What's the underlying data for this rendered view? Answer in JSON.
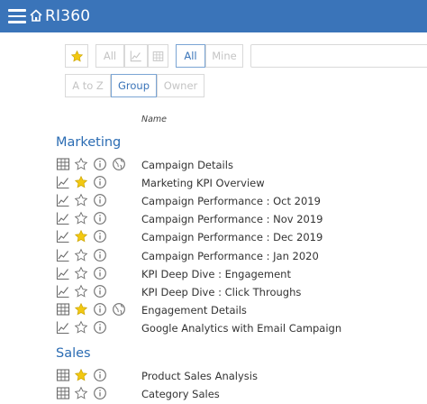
{
  "app": {
    "title": "RI360"
  },
  "toolbar": {
    "type_filters": {
      "all": "All"
    },
    "ownership_filters": {
      "all": "All",
      "mine": "Mine"
    },
    "sort": {
      "a_to_z": "A to Z",
      "group": "Group",
      "owner": "Owner"
    },
    "search_value": ""
  },
  "list": {
    "column_header": "Name",
    "groups": [
      {
        "name": "Marketing",
        "items": [
          {
            "label": "Campaign Details",
            "type": "table",
            "favorite": false,
            "shared": true
          },
          {
            "label": "Marketing KPI Overview",
            "type": "chart",
            "favorite": true,
            "shared": false
          },
          {
            "label": "Campaign Performance : Oct 2019",
            "type": "chart",
            "favorite": false,
            "shared": false
          },
          {
            "label": "Campaign Performance : Nov 2019",
            "type": "chart",
            "favorite": false,
            "shared": false
          },
          {
            "label": "Campaign Performance : Dec 2019",
            "type": "chart",
            "favorite": true,
            "shared": false
          },
          {
            "label": "Campaign Performance : Jan 2020",
            "type": "chart",
            "favorite": false,
            "shared": false
          },
          {
            "label": "KPI Deep Dive : Engagement",
            "type": "chart",
            "favorite": false,
            "shared": false
          },
          {
            "label": "KPI Deep Dive : Click Throughs",
            "type": "chart",
            "favorite": false,
            "shared": false
          },
          {
            "label": "Engagement Details",
            "type": "table",
            "favorite": true,
            "shared": true
          },
          {
            "label": "Google Analytics with Email Campaign",
            "type": "chart",
            "favorite": false,
            "shared": false
          }
        ]
      },
      {
        "name": "Sales",
        "items": [
          {
            "label": "Product Sales Analysis",
            "type": "table",
            "favorite": true,
            "shared": false
          },
          {
            "label": "Category Sales",
            "type": "table",
            "favorite": false,
            "shared": false
          }
        ]
      }
    ]
  },
  "colors": {
    "header": "#3a74b9",
    "accent": "#2b6cb3",
    "star": "#f2c811",
    "icon": "#6b6b6b"
  },
  "icons": {
    "table": "table-icon",
    "chart": "line-chart-icon",
    "favorite": "star-icon",
    "info": "info-icon",
    "shared": "globe-icon"
  }
}
